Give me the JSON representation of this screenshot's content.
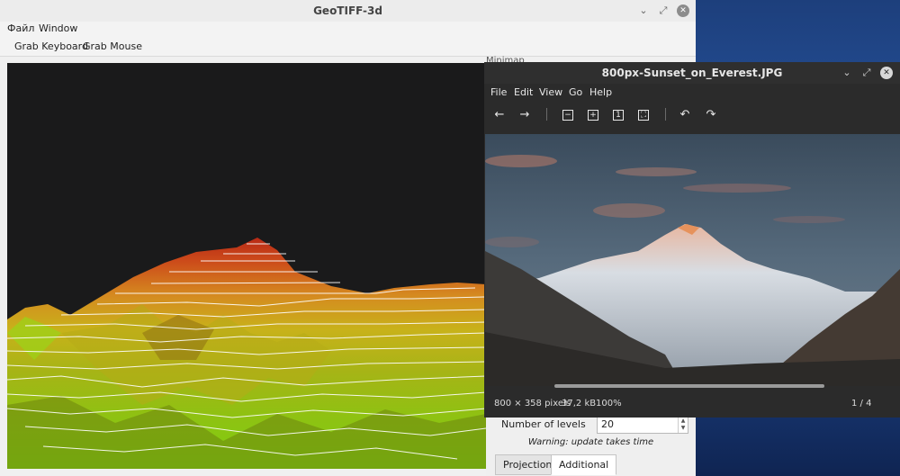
{
  "geo_window": {
    "title": "GeoTIFF-3d",
    "menu": [
      "Файл",
      "Window"
    ],
    "toolbar": [
      "Grab Keyboard",
      "Grab Mouse"
    ],
    "minimap_label": "Minimap",
    "levels_label": "Number of levels",
    "levels_value": "20",
    "warning": "Warning: update takes time",
    "tabs": [
      "Projection",
      "Additional"
    ],
    "active_tab": "Additional"
  },
  "viewer_window": {
    "title": "800px-Sunset_on_Everest.JPG",
    "menu": [
      "File",
      "Edit",
      "View",
      "Go",
      "Help"
    ],
    "status": {
      "dimensions": "800 × 358 pixels",
      "filesize": "37,2 kB",
      "zoom": "100%",
      "position": "1 / 4"
    }
  },
  "icons": {
    "back": "arrow-left-icon",
    "forward": "arrow-right-icon",
    "zoom_out": "zoom-out-icon",
    "zoom_in": "zoom-in-icon",
    "zoom_normal": "zoom-normal-icon",
    "zoom_fit": "zoom-fit-icon",
    "rotate_left": "rotate-left-icon",
    "rotate_right": "rotate-right-icon"
  },
  "colors": {
    "desktop": "#2a5aa8",
    "viewer_bg": "#2b2b2b",
    "terrain_peak": "#c0361a",
    "terrain_low": "#8bcf12"
  }
}
